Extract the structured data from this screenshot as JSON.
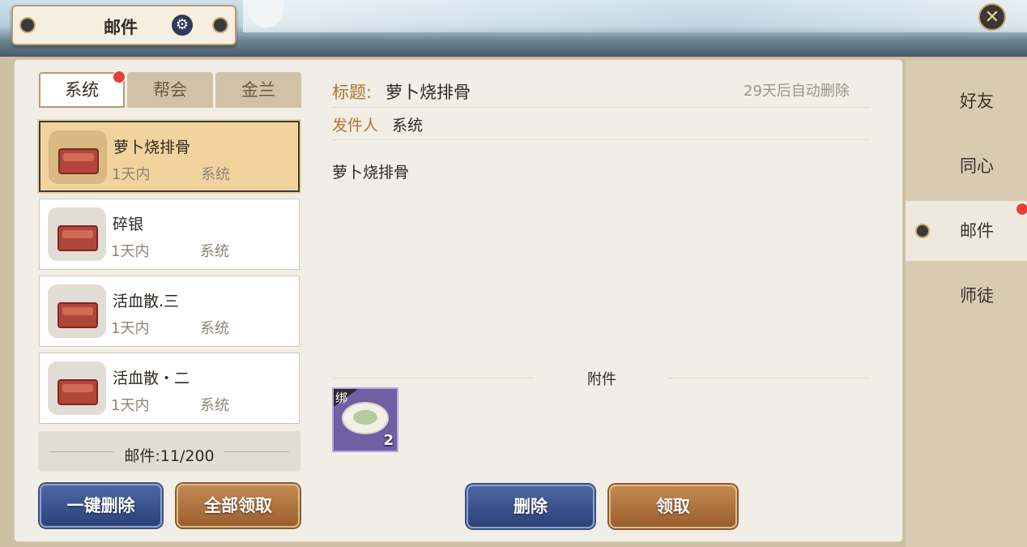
{
  "header": {
    "title": "邮件",
    "settings_icon": "gear-icon",
    "close_icon": "close-icon"
  },
  "tabs": [
    {
      "label": "系统",
      "active": true,
      "has_badge": true
    },
    {
      "label": "帮会",
      "active": false
    },
    {
      "label": "金兰",
      "active": false
    }
  ],
  "mail_list": [
    {
      "name": "萝卜烧排骨",
      "time": "1天内",
      "sender": "系统",
      "selected": true,
      "icon": "chest-icon"
    },
    {
      "name": "碎银",
      "time": "1天内",
      "sender": "系统",
      "selected": false,
      "icon": "chest-icon"
    },
    {
      "name": "活血散.三",
      "time": "1天内",
      "sender": "系统",
      "selected": false,
      "icon": "chest-icon"
    },
    {
      "name": "活血散・二",
      "time": "1天内",
      "sender": "系统",
      "selected": false,
      "icon": "chest-icon"
    }
  ],
  "mail_count": "邮件:11/200",
  "buttons": {
    "delete_all": "一键删除",
    "claim_all": "全部领取",
    "delete": "删除",
    "claim": "领取"
  },
  "detail": {
    "title_label": "标题:",
    "title_value": "萝卜烧排骨",
    "auto_delete": "29天后自动删除",
    "sender_label": "发件人",
    "sender_value": "系统",
    "body": "萝卜烧排骨",
    "attachment_label": "附件",
    "attachment": {
      "bind_tag": "绑",
      "quantity": "2",
      "icon": "bowl-food-icon"
    }
  },
  "side_nav": [
    {
      "label": "好友",
      "active": false
    },
    {
      "label": "同心",
      "active": false
    },
    {
      "label": "邮件",
      "active": true,
      "has_badge": true
    },
    {
      "label": "师徒",
      "active": false
    }
  ],
  "colors": {
    "accent_label": "#b0762e",
    "blue_button": "#2b4279",
    "brown_button": "#9a5f2e",
    "badge": "#e83e34",
    "selected_item": "#f3d39d"
  }
}
